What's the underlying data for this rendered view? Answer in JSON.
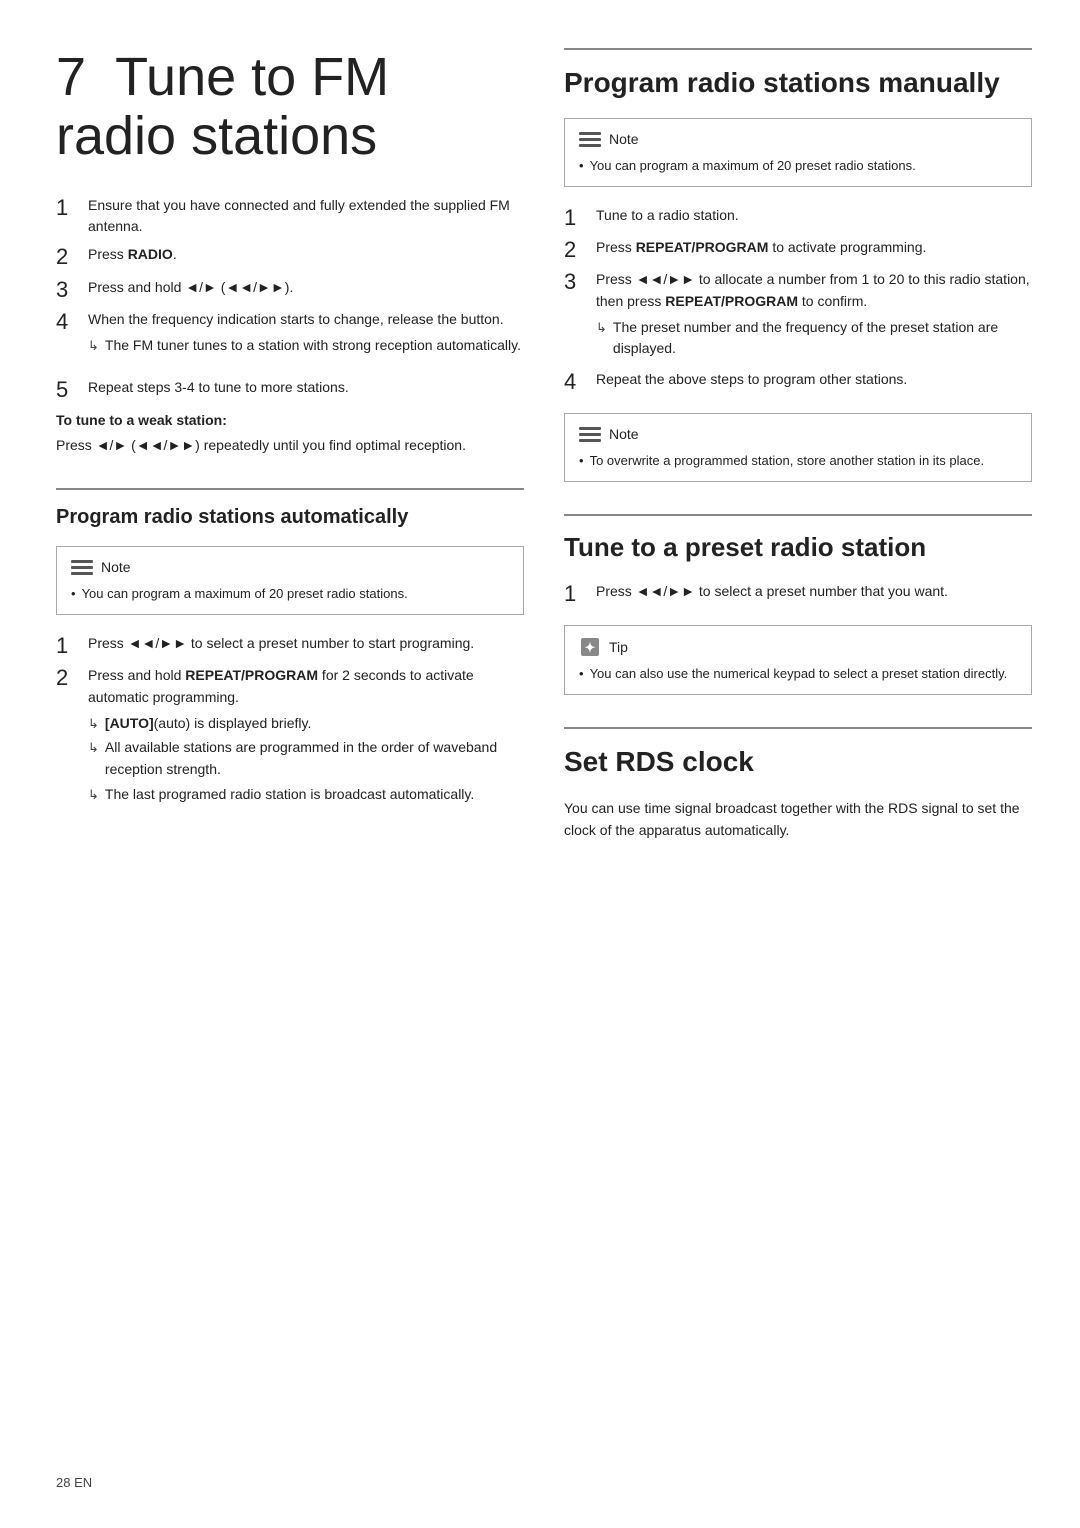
{
  "page": {
    "footer": "28    EN"
  },
  "left": {
    "title": {
      "chapter": "7",
      "text": "Tune to FM radio stations"
    },
    "main_steps": [
      {
        "num": "1",
        "text": "Ensure that you have connected and fully extended the supplied FM antenna."
      },
      {
        "num": "2",
        "text_prefix": "Press ",
        "bold": "RADIO",
        "text_suffix": "."
      },
      {
        "num": "3",
        "text_prefix": "Press and hold ",
        "symbol": "◄/► (◄◄/►►)",
        "text_suffix": "."
      },
      {
        "num": "4",
        "text": "When the frequency indication starts to change, release the button.",
        "arrows": [
          "The FM tuner tunes to a station with strong reception automatically."
        ]
      }
    ],
    "step5": {
      "num": "5",
      "text": "Repeat steps 3-4 to tune to more stations."
    },
    "weak_label": "To tune to a weak station:",
    "weak_text": "Press ◄/► (◄◄/►►) repeatedly until you find optimal reception.",
    "auto_section": {
      "heading": "Program radio stations automatically",
      "note": {
        "label": "Note",
        "bullets": [
          "You can program a maximum of 20 preset radio stations."
        ]
      },
      "steps": [
        {
          "num": "1",
          "text": "Press ◄◄/►► to select a preset number to start programing."
        },
        {
          "num": "2",
          "text_prefix": "Press and hold ",
          "bold": "REPEAT/PROGRAM",
          "text_suffix": " for 2 seconds to activate automatic programming.",
          "arrows": [
            "[AUTO] (auto) is displayed briefly.",
            "All available stations are programmed in the order of waveband reception strength.",
            "The last programed radio station is broadcast automatically."
          ]
        }
      ]
    }
  },
  "right": {
    "manual_section": {
      "heading": "Program radio stations manually",
      "note": {
        "label": "Note",
        "bullets": [
          "You can program a maximum of 20 preset radio stations."
        ]
      },
      "steps": [
        {
          "num": "1",
          "text": "Tune to a radio station."
        },
        {
          "num": "2",
          "text_prefix": "Press ",
          "bold": "REPEAT/PROGRAM",
          "text_suffix": " to activate programming."
        },
        {
          "num": "3",
          "text_prefix": "Press ◄◄/►► to allocate a number from 1 to 20 to this radio station, then press ",
          "bold": "REPEAT/PROGRAM",
          "text_suffix": " to confirm.",
          "arrows": [
            "The preset number and the frequency of the preset station are displayed."
          ]
        },
        {
          "num": "4",
          "text": "Repeat the above steps to program other stations."
        }
      ],
      "note2": {
        "label": "Note",
        "bullets": [
          "To overwrite a programmed station, store another station in its place."
        ]
      }
    },
    "preset_section": {
      "heading": "Tune to a preset radio station",
      "steps": [
        {
          "num": "1",
          "text": "Press ◄◄/►► to select a preset number that you want."
        }
      ],
      "tip": {
        "label": "Tip",
        "bullets": [
          "You can also use the numerical keypad to select a preset station directly."
        ]
      }
    },
    "rds_section": {
      "heading": "Set RDS clock",
      "text": "You can use time signal broadcast together with the RDS signal to set the clock of the apparatus automatically."
    }
  }
}
